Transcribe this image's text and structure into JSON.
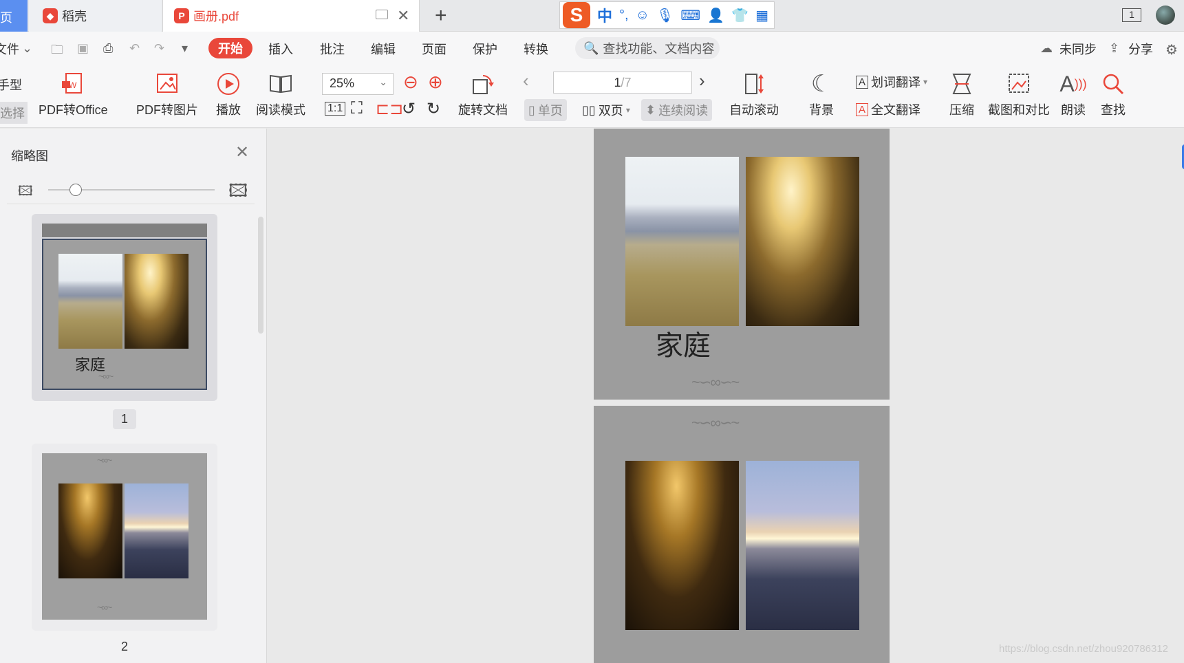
{
  "tabs": {
    "first_partial": "页",
    "home": "稻壳",
    "file": "画册.pdf"
  },
  "ime": {
    "lang": "中",
    "punct": "°,"
  },
  "window": {
    "num": "1"
  },
  "menu": {
    "file": "文件",
    "start": "开始",
    "items": [
      "插入",
      "批注",
      "编辑",
      "页面",
      "保护",
      "转换"
    ],
    "search_placeholder": "查找功能、文档内容",
    "sync": "未同步",
    "share": "分享"
  },
  "ribbon": {
    "left_partial_top": "手型",
    "left_partial_bottom": "选择",
    "pdf_to_office": "PDF转Office",
    "pdf_to_image": "PDF转图片",
    "play": "播放",
    "read_mode": "阅读模式",
    "zoom": "25%",
    "rotate_doc": "旋转文档",
    "page_current": "1",
    "page_total": "/7",
    "single_page": "单页",
    "double_page": "双页",
    "continuous": "连续阅读",
    "auto_scroll": "自动滚动",
    "background": "背景",
    "word_translate": "划词翻译",
    "full_translate": "全文翻译",
    "compress": "压缩",
    "screenshot_compare": "截图和对比",
    "read_aloud": "朗读",
    "find": "查找"
  },
  "sidebar": {
    "title": "缩略图",
    "pages": [
      {
        "num": "1",
        "caption": "家庭"
      },
      {
        "num": "2"
      }
    ]
  },
  "document": {
    "page1_title": "家庭"
  },
  "watermark": "https://blog.csdn.net/zhou920786312",
  "colors": {
    "accent": "#e9473a",
    "ime": "#ee5b25",
    "page_bg": "#9d9d9d"
  }
}
